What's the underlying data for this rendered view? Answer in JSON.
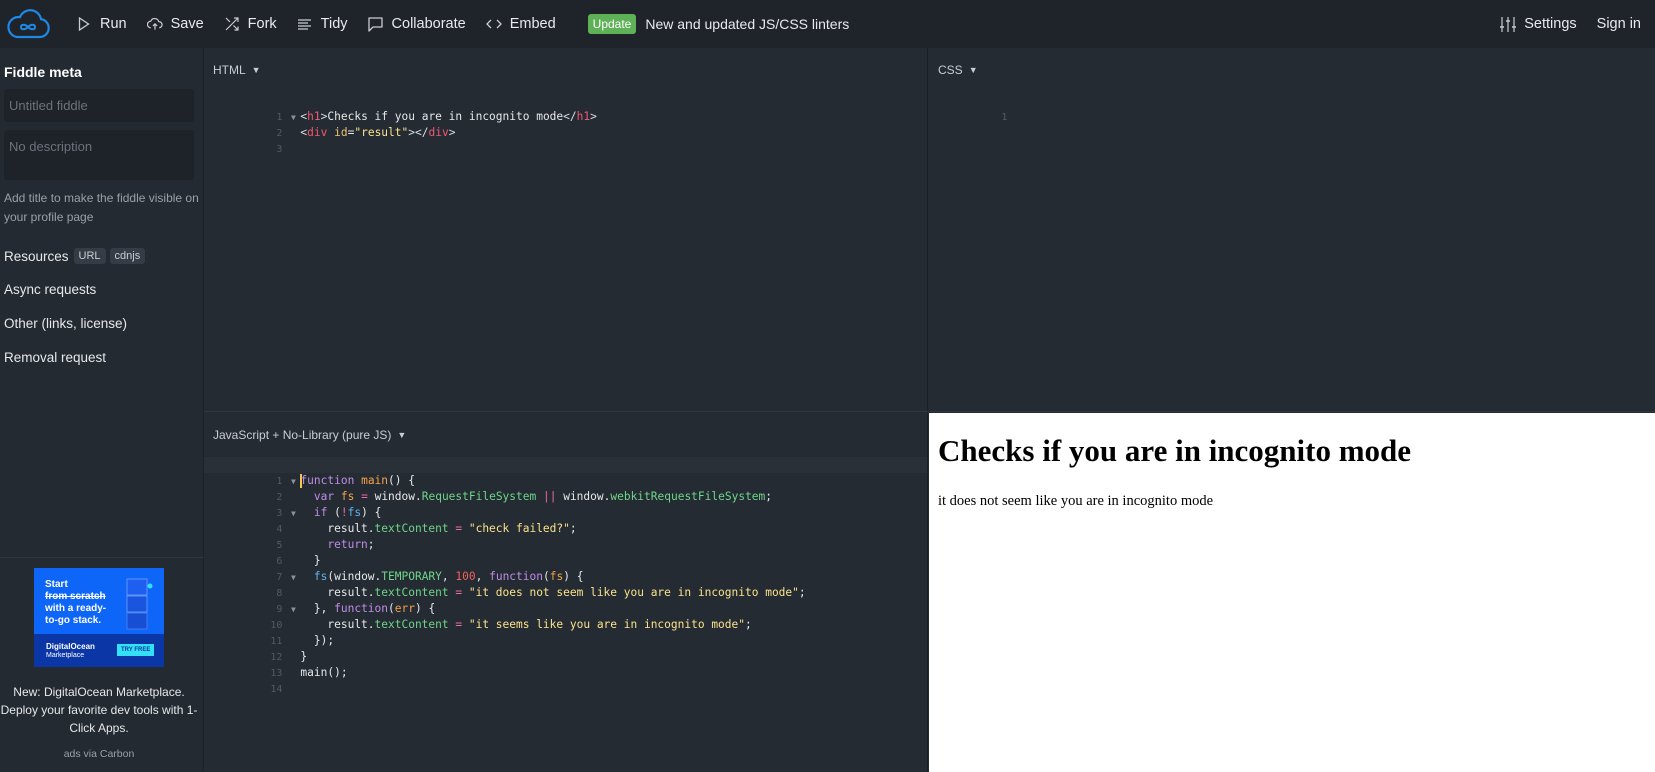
{
  "topbar": {
    "logo": "jsfiddle-cloud-logo",
    "buttons": [
      {
        "label": "Run",
        "icon": "play-icon"
      },
      {
        "label": "Save",
        "icon": "cloud-upload-icon"
      },
      {
        "label": "Fork",
        "icon": "fork-icon"
      },
      {
        "label": "Tidy",
        "icon": "align-lines-icon"
      },
      {
        "label": "Collaborate",
        "icon": "chat-bubble-icon"
      },
      {
        "label": "Embed",
        "icon": "code-brackets-icon"
      }
    ],
    "update_badge": "Update",
    "update_text": "New and updated JS/CSS linters",
    "settings_label": "Settings",
    "signin_label": "Sign in"
  },
  "sidebar": {
    "title": "Fiddle meta",
    "title_placeholder": "Untitled fiddle",
    "description_placeholder": "No description",
    "hint": "Add title to make the fiddle visible on your profile page",
    "resources_label": "Resources",
    "resource_chips": [
      "URL",
      "cdnjs"
    ],
    "links": [
      "Async requests",
      "Other (links, license)",
      "Removal request"
    ],
    "ad": {
      "line1": "Start",
      "line2_struck": "from scratch",
      "line3": "with a ready-",
      "line4": "to-go stack.",
      "brand": "DigitalOcean",
      "brand_sub": "Marketplace",
      "cta": "TRY FREE",
      "caption": "New: DigitalOcean Marketplace. Deploy your favorite dev tools with 1-Click Apps.",
      "via": "ads via Carbon"
    }
  },
  "panels": {
    "html": {
      "label": "HTML",
      "line_numbers": [
        "1",
        "2",
        "3"
      ]
    },
    "css": {
      "label": "CSS",
      "line_numbers": [
        "1"
      ]
    },
    "js": {
      "label": "JavaScript + No-Library (pure JS)",
      "line_numbers": [
        "1",
        "2",
        "3",
        "4",
        "5",
        "6",
        "7",
        "8",
        "9",
        "10",
        "11",
        "12",
        "13",
        "14"
      ]
    },
    "result": {
      "heading": "Checks if you are in incognito mode",
      "text": "it does not seem like you are in incognito mode"
    }
  },
  "code": {
    "html": {
      "l1": {
        "o1": "<",
        "t1": "h1",
        "c1": ">",
        "text": "Checks if you are in incognito mode",
        "o2": "</",
        "t2": "h1",
        "c2": ">"
      },
      "l2": {
        "o1": "<",
        "t1": "div",
        "attr": " id",
        "eq": "=",
        "val": "\"result\"",
        "c1": ">",
        "o2": "</",
        "t2": "div",
        "c2": ">"
      }
    },
    "js": {
      "l1": {
        "kw": "unction",
        "kw_first": "f",
        "sp": " ",
        "fn": "main",
        "rest": "() {"
      },
      "l2": {
        "ind": "  ",
        "kw": "var",
        "sp": " ",
        "v": "fs",
        "eq": " = ",
        "obj": "window.",
        "p1": "RequestFileSystem",
        "or": " || ",
        "obj2": "window.",
        "p2": "webkitRequestFileSystem",
        "end": ";"
      },
      "l3": {
        "ind": "  ",
        "kw": "if",
        "a": " (",
        "op": "!",
        "v": "fs",
        "b": ") {"
      },
      "l4": {
        "ind": "    ",
        "obj": "result.",
        "p": "textContent",
        "eq": " = ",
        "str": "\"check failed?\"",
        "end": ";"
      },
      "l5": {
        "ind": "    ",
        "kw": "return",
        "end": ";"
      },
      "l6": {
        "ind": "  ",
        "t": "}"
      },
      "l7": {
        "ind": "  ",
        "v": "fs",
        "a": "(window.",
        "p": "TEMPORARY",
        "c": ", ",
        "num": "100",
        "c2": ", ",
        "kw": "function",
        "b": "(",
        "arg": "fs",
        "d": ") {"
      },
      "l8": {
        "ind": "    ",
        "obj": "result.",
        "p": "textContent",
        "eq": " = ",
        "str": "\"it does not seem like you are in incognito mode\"",
        "end": ";"
      },
      "l9": {
        "ind": "  ",
        "a": "}, ",
        "kw": "function",
        "b": "(",
        "arg": "err",
        "d": ") {"
      },
      "l10": {
        "ind": "    ",
        "obj": "result.",
        "p": "textContent",
        "eq": " = ",
        "str": "\"it seems like you are in incognito mode\"",
        "end": ";"
      },
      "l11": {
        "ind": "  ",
        "t": "});"
      },
      "l12": {
        "t": "}"
      },
      "l13": {
        "t": "main();"
      }
    }
  }
}
